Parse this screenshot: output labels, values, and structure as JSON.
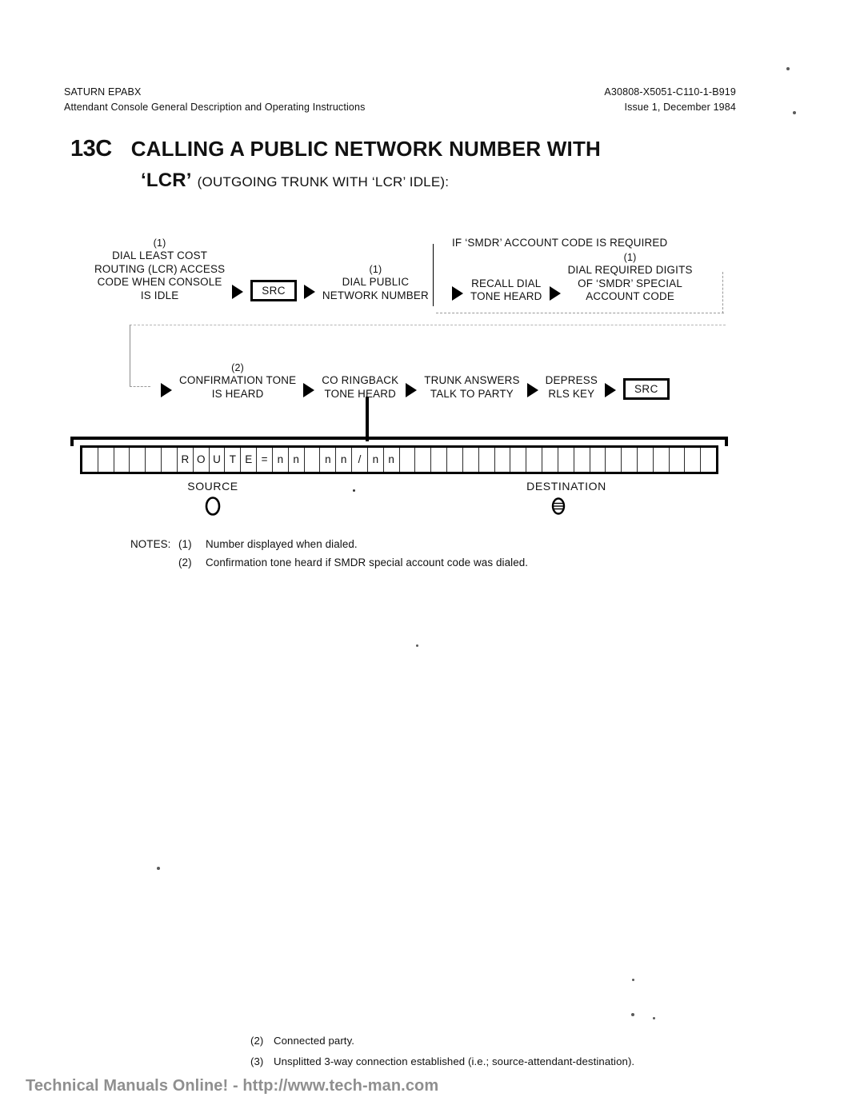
{
  "header": {
    "left_line1": "SATURN EPABX",
    "left_line2": "Attendant Console General Description and Operating Instructions",
    "right_line1": "A30808-X5051-C110-1-B919",
    "right_line2": "Issue 1, December 1984"
  },
  "title": {
    "number": "13C",
    "main": "CALLING A PUBLIC NETWORK NUMBER WITH",
    "lcr": "‘LCR’",
    "subtitle": "(OUTGOING TRUNK WITH ‘LCR’ IDLE):"
  },
  "flow": {
    "row1": [
      {
        "type": "step",
        "note_ref": "(1)",
        "lines": [
          "DIAL LEAST COST",
          "ROUTING (LCR) ACCESS",
          "CODE WHEN CONSOLE",
          "IS IDLE"
        ]
      },
      {
        "type": "arrow"
      },
      {
        "type": "key",
        "label": "SRC"
      },
      {
        "type": "arrow"
      },
      {
        "type": "step",
        "note_ref": "(1)",
        "lines": [
          "DIAL PUBLIC",
          "NETWORK NUMBER"
        ]
      }
    ],
    "smdr_header": "IF ‘SMDR’ ACCOUNT CODE IS REQUIRED",
    "row1_smdr": [
      {
        "type": "arrow"
      },
      {
        "type": "step",
        "note_ref": "",
        "lines": [
          "RECALL DIAL",
          "TONE  HEARD"
        ]
      },
      {
        "type": "arrow"
      },
      {
        "type": "step",
        "note_ref": "(1)",
        "lines": [
          "DIAL REQUIRED DIGITS",
          "OF ‘SMDR’ SPECIAL",
          "ACCOUNT CODE"
        ]
      }
    ],
    "row2": [
      {
        "type": "arrow"
      },
      {
        "type": "step",
        "note_ref": "(2)",
        "lines": [
          "CONFIRMATION TONE",
          "IS HEARD"
        ]
      },
      {
        "type": "arrow"
      },
      {
        "type": "step",
        "note_ref": "",
        "lines": [
          "CO RINGBACK",
          "TONE HEARD"
        ]
      },
      {
        "type": "arrow"
      },
      {
        "type": "step",
        "note_ref": "",
        "lines": [
          "TRUNK ANSWERS",
          "TALK TO PARTY"
        ]
      },
      {
        "type": "arrow"
      },
      {
        "type": "step",
        "note_ref": "",
        "lines": [
          "DEPRESS",
          "RLS KEY"
        ]
      },
      {
        "type": "arrow"
      },
      {
        "type": "key",
        "label": "SRC"
      }
    ]
  },
  "display": {
    "total_cells": 40,
    "cells": [
      "",
      "",
      "",
      "",
      "",
      "",
      "R",
      "O",
      "U",
      "T",
      "E",
      "=",
      "n",
      "n",
      "",
      "n",
      "n",
      "/",
      "n",
      "n",
      "",
      "",
      "",
      "",
      "",
      "",
      "",
      "",
      "",
      "",
      "",
      "",
      "",
      "",
      "",
      "",
      "",
      "",
      "",
      ""
    ],
    "source_label": "SOURCE",
    "destination_label": "DESTINATION",
    "source_lamp": "lamp-off-circle",
    "destination_lamp": "lamp-slow-flash-circle"
  },
  "notes": {
    "label": "NOTES:",
    "items": [
      {
        "index": "(1)",
        "text": "Number displayed when dialed."
      },
      {
        "index": "(2)",
        "text": "Confirmation tone heard if SMDR special account code was dialed."
      }
    ]
  },
  "bottom_notes": [
    {
      "index": "(2)",
      "text": "Connected party."
    },
    {
      "index": "(3)",
      "text": "Unsplitted 3-way connection established (i.e.; source-attendant-destination)."
    }
  ],
  "footer": {
    "watermark": "Technical Manuals Online! - http://www.tech-man.com"
  },
  "colors": {
    "ink": "#111111",
    "paper": "#ffffff",
    "watermark": "#8f8f8f",
    "dashed_guide": "#9a9a9a"
  }
}
